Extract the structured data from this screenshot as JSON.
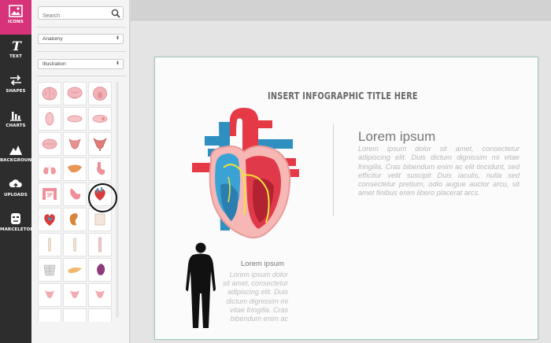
{
  "rail": {
    "items": [
      {
        "label": "ICONS",
        "icon": "image-icon"
      },
      {
        "label": "TEXT",
        "icon": "text-icon"
      },
      {
        "label": "SHAPES",
        "icon": "shapes-icon"
      },
      {
        "label": "CHARTS",
        "icon": "chart-icon"
      },
      {
        "label": "BACKGROUND",
        "icon": "mountain-icon"
      },
      {
        "label": "UPLOADS",
        "icon": "cloud-upload-icon"
      },
      {
        "label": "MARCELETOR",
        "icon": "face-icon"
      }
    ],
    "active_color": "#d6337a"
  },
  "panel": {
    "search_placeholder": "Search",
    "category": "Anatomy",
    "style": "Illustration"
  },
  "canvas": {
    "title": "INSERT INFOGRAPHIC TITLE HERE",
    "heading_main": "Lorem ipsum",
    "body_main": "Lorem ipsum dolor sit amet, consectetur adipiscing elit. Duis dictum dignissim mi vitae fringilla. Cras bibendum enim ac elit tincidunt, sed efficitur velit suscipit Duis iaculis, nulla sed consectetur pretium, odio augue auctor arcu, sit amet finibus enim libero placerat arcs.",
    "heading_small": "Lorem ipsum",
    "body_small": "Lorem ipsum dolor sit amet, consectetur adipiscing elit. Duis dictum dignissim mi vitae fringilla. Cras bibendum enim ac"
  }
}
